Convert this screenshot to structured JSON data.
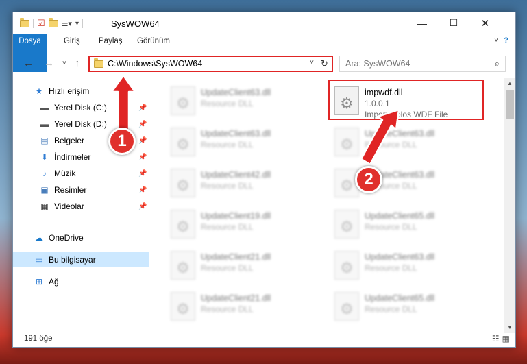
{
  "window": {
    "title": "SysWOW64",
    "controls": {
      "minimize": "—",
      "maximize": "☐",
      "close": "✕"
    }
  },
  "ribbon": {
    "tabs": [
      "Dosya",
      "Giriş",
      "Paylaş",
      "Görünüm"
    ],
    "expand": "˅",
    "help": "?"
  },
  "address": {
    "path": "C:\\Windows\\SysWOW64",
    "refresh": "↻",
    "dropdown": "˅"
  },
  "search": {
    "placeholder": "Ara: SysWOW64",
    "icon": "⌕"
  },
  "nav": {
    "back": "←",
    "forward": "→",
    "recent": "˅",
    "up": "↑"
  },
  "sidebar": {
    "items": [
      {
        "label": "Hızlı erişim",
        "icon": "star-icon"
      },
      {
        "label": "Yerel Disk (C:)",
        "icon": "drive-icon"
      },
      {
        "label": "Yerel Disk (D:)",
        "icon": "drive-icon"
      },
      {
        "label": "Belgeler",
        "icon": "documents-icon"
      },
      {
        "label": "İndirmeler",
        "icon": "download-icon"
      },
      {
        "label": "Müzik",
        "icon": "music-icon"
      },
      {
        "label": "Resimler",
        "icon": "pictures-icon"
      },
      {
        "label": "Videolar",
        "icon": "video-icon"
      },
      {
        "label": "OneDrive",
        "icon": "cloud-icon"
      },
      {
        "label": "Bu bilgisayar",
        "icon": "computer-icon"
      },
      {
        "label": "Ağ",
        "icon": "network-icon"
      }
    ],
    "pin": "📌"
  },
  "files": {
    "highlighted": {
      "name": "impwdf.dll",
      "version": "1.0.0.1",
      "description": "Import Holos WDF File"
    },
    "left_column": [
      {
        "name": "UpdateClient63.dll",
        "type": "Resource DLL"
      },
      {
        "name": "UpdateClient63.dll",
        "type": "Resource DLL"
      },
      {
        "name": "UpdateClient42.dll",
        "type": "Resource DLL"
      },
      {
        "name": "UpdateClient19.dll",
        "type": "Resource DLL"
      },
      {
        "name": "UpdateClient21.dll",
        "type": "Resource DLL"
      },
      {
        "name": "UpdateClient21.dll",
        "type": "Resource DLL"
      }
    ],
    "right_column": [
      {
        "name": "UpdateClient63.dll",
        "type": "Resource DLL"
      },
      {
        "name": "UpdateClient63.dll",
        "type": "Resource DLL"
      },
      {
        "name": "UpdateClient65.dll",
        "type": "Resource DLL"
      },
      {
        "name": "UpdateClient63.dll",
        "type": "Resource DLL"
      },
      {
        "name": "UpdateClient65.dll",
        "type": "Resource DLL"
      }
    ]
  },
  "status": {
    "count": "191 öğe"
  },
  "annotations": {
    "step1": "1",
    "step2": "2",
    "color": "#e02525"
  }
}
